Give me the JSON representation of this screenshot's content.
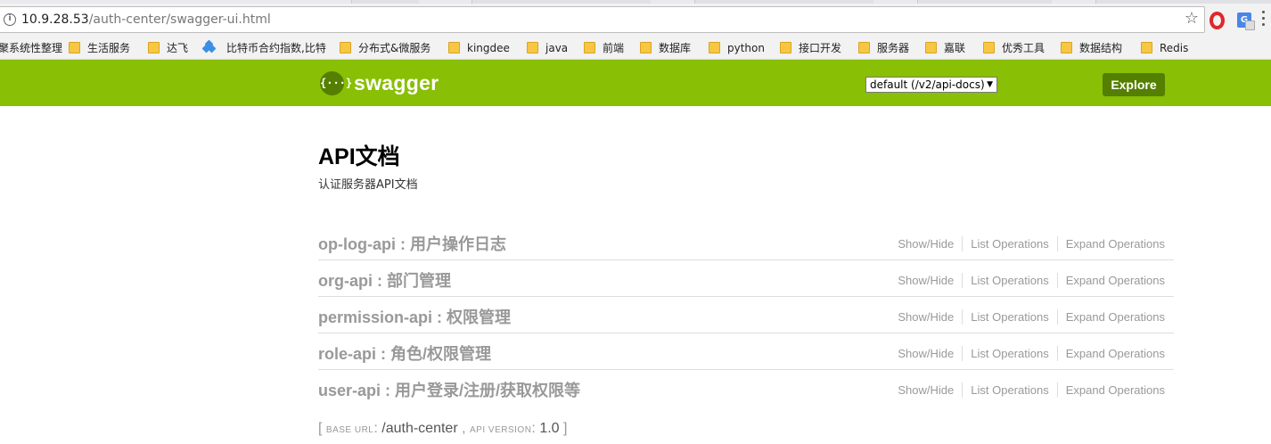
{
  "browser": {
    "url_host": "10.9.28.53",
    "url_path": "/auth-center/swagger-ui.html",
    "bookmarks": [
      {
        "label": "聚系统性整理",
        "icon": "none"
      },
      {
        "label": "生活服务",
        "icon": "folder-icon"
      },
      {
        "label": "达飞",
        "icon": "folder-icon"
      },
      {
        "label": "比特币合约指数,比特",
        "icon": "diamond-icon"
      },
      {
        "label": "分布式&微服务",
        "icon": "folder-icon"
      },
      {
        "label": "kingdee",
        "icon": "folder-icon"
      },
      {
        "label": "java",
        "icon": "folder-icon"
      },
      {
        "label": "前端",
        "icon": "folder-icon"
      },
      {
        "label": "数据库",
        "icon": "folder-icon"
      },
      {
        "label": "python",
        "icon": "folder-icon"
      },
      {
        "label": "接口开发",
        "icon": "folder-icon"
      },
      {
        "label": "服务器",
        "icon": "folder-icon"
      },
      {
        "label": "嘉联",
        "icon": "folder-icon"
      },
      {
        "label": "优秀工具",
        "icon": "folder-icon"
      },
      {
        "label": "数据结构",
        "icon": "folder-icon"
      },
      {
        "label": "Redis",
        "icon": "folder-icon"
      }
    ]
  },
  "header": {
    "logo_glyph": "{···}",
    "logo_text": "swagger",
    "spec_selected": "default (/v2/api-docs)",
    "explore_label": "Explore",
    "brand_color": "#89bf04"
  },
  "info": {
    "title": "API文档",
    "description": "认证服务器API文档"
  },
  "resources": [
    {
      "name": "op-log-api : 用户操作日志"
    },
    {
      "name": "org-api : 部门管理"
    },
    {
      "name": "permission-api : 权限管理"
    },
    {
      "name": "role-api : 角色/权限管理"
    },
    {
      "name": "user-api : 用户登录/注册/获取权限等"
    }
  ],
  "ops_labels": {
    "show_hide": "Show/Hide",
    "list_operations": "List Operations",
    "expand_operations": "Expand Operations"
  },
  "footer": {
    "open_bracket": "[",
    "base_url_label": "base url",
    "base_url_value": "/auth-center",
    "separator": ",",
    "api_version_label": "api version",
    "api_version_value": "1.0",
    "close_bracket": "]"
  }
}
